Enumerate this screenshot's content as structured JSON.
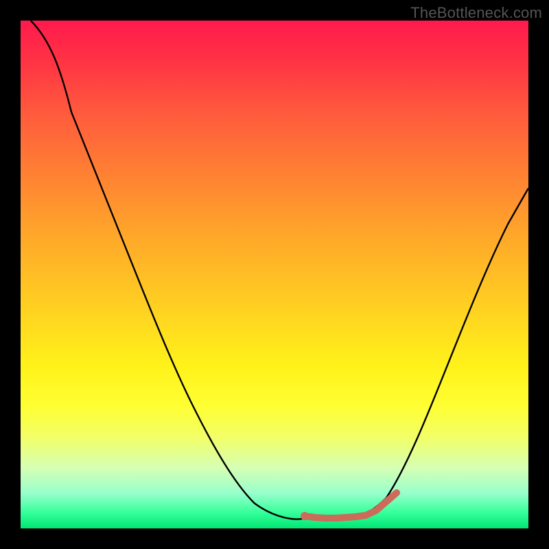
{
  "watermark": "TheBottleneck.com",
  "chart_data": {
    "type": "line",
    "title": "",
    "xlabel": "",
    "ylabel": "",
    "xlim": [
      0,
      100
    ],
    "ylim": [
      0,
      100
    ],
    "series": [
      {
        "name": "bottleneck-curve",
        "color": "#000000",
        "x": [
          2,
          6,
          10,
          14,
          18,
          22,
          26,
          30,
          34,
          38,
          42,
          46,
          50,
          54,
          56,
          58,
          62,
          66,
          70,
          74,
          78,
          82,
          86,
          90,
          94,
          98
        ],
        "y": [
          100,
          96,
          90,
          82,
          74,
          66,
          58,
          50,
          42,
          34,
          27,
          20,
          13,
          6,
          3,
          2,
          2,
          2,
          3,
          5,
          12,
          22,
          32,
          42,
          52,
          62
        ]
      },
      {
        "name": "optimal-range-marker",
        "color": "#cc6b5a",
        "x": [
          56,
          58,
          60,
          62,
          64,
          66,
          68,
          70,
          72,
          74
        ],
        "y": [
          2.5,
          2,
          2,
          2,
          2,
          2,
          2,
          2.5,
          3.5,
          6
        ]
      }
    ],
    "gradient_stops": [
      {
        "pos": 0,
        "color": "#ff1a4d"
      },
      {
        "pos": 8,
        "color": "#ff3344"
      },
      {
        "pos": 18,
        "color": "#ff5a3d"
      },
      {
        "pos": 30,
        "color": "#ff8033"
      },
      {
        "pos": 42,
        "color": "#ffa62a"
      },
      {
        "pos": 55,
        "color": "#ffcc22"
      },
      {
        "pos": 68,
        "color": "#fff21a"
      },
      {
        "pos": 76,
        "color": "#ffff33"
      },
      {
        "pos": 82,
        "color": "#f2ff66"
      },
      {
        "pos": 88,
        "color": "#d6ffb3"
      },
      {
        "pos": 93,
        "color": "#99ffcc"
      },
      {
        "pos": 97,
        "color": "#33ff99"
      },
      {
        "pos": 100,
        "color": "#00e673"
      }
    ]
  }
}
